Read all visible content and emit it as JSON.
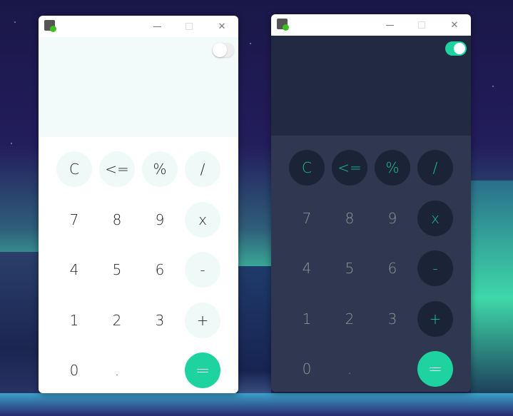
{
  "colors": {
    "accent": "#1ed3a0",
    "dark_display": "#212a40",
    "dark_keypad": "#2f3850",
    "dark_op_button": "#1b2336",
    "light_display": "#f2fbf9",
    "light_op_button": "#effaf8"
  },
  "icons": {
    "app": "calculator-icon",
    "minimize": "minimize-icon",
    "maximize": "maximize-icon",
    "close": "close-icon"
  },
  "titlebar": {
    "close": "✕"
  },
  "windows": [
    {
      "theme": "light",
      "dark_mode_toggle": false
    },
    {
      "theme": "dark",
      "dark_mode_toggle": true
    }
  ],
  "keys": [
    [
      {
        "label": "C",
        "type": "op"
      },
      {
        "label": "<=",
        "type": "op"
      },
      {
        "label": "%",
        "type": "op"
      },
      {
        "label": "/",
        "type": "op"
      }
    ],
    [
      {
        "label": "7"
      },
      {
        "label": "8"
      },
      {
        "label": "9"
      },
      {
        "label": "x",
        "type": "op"
      }
    ],
    [
      {
        "label": "4"
      },
      {
        "label": "5"
      },
      {
        "label": "6"
      },
      {
        "label": "-",
        "type": "op"
      }
    ],
    [
      {
        "label": "1"
      },
      {
        "label": "2"
      },
      {
        "label": "3"
      },
      {
        "label": "+",
        "type": "op"
      }
    ],
    [
      {
        "label": "0"
      },
      {
        "label": "."
      },
      {
        "label": ""
      },
      {
        "label": "=",
        "type": "eq"
      }
    ]
  ]
}
